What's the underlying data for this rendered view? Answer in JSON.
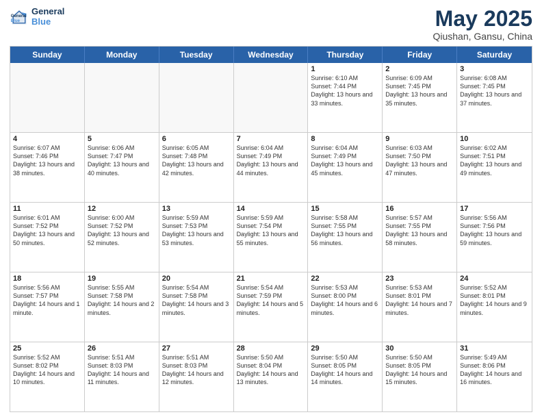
{
  "logo": {
    "line1": "General",
    "line2": "Blue"
  },
  "title": "May 2025",
  "subtitle": "Qiushan, Gansu, China",
  "dayHeaders": [
    "Sunday",
    "Monday",
    "Tuesday",
    "Wednesday",
    "Thursday",
    "Friday",
    "Saturday"
  ],
  "rows": [
    [
      {
        "num": "",
        "info": ""
      },
      {
        "num": "",
        "info": ""
      },
      {
        "num": "",
        "info": ""
      },
      {
        "num": "",
        "info": ""
      },
      {
        "num": "1",
        "info": "Sunrise: 6:10 AM\nSunset: 7:44 PM\nDaylight: 13 hours\nand 33 minutes."
      },
      {
        "num": "2",
        "info": "Sunrise: 6:09 AM\nSunset: 7:45 PM\nDaylight: 13 hours\nand 35 minutes."
      },
      {
        "num": "3",
        "info": "Sunrise: 6:08 AM\nSunset: 7:45 PM\nDaylight: 13 hours\nand 37 minutes."
      }
    ],
    [
      {
        "num": "4",
        "info": "Sunrise: 6:07 AM\nSunset: 7:46 PM\nDaylight: 13 hours\nand 38 minutes."
      },
      {
        "num": "5",
        "info": "Sunrise: 6:06 AM\nSunset: 7:47 PM\nDaylight: 13 hours\nand 40 minutes."
      },
      {
        "num": "6",
        "info": "Sunrise: 6:05 AM\nSunset: 7:48 PM\nDaylight: 13 hours\nand 42 minutes."
      },
      {
        "num": "7",
        "info": "Sunrise: 6:04 AM\nSunset: 7:49 PM\nDaylight: 13 hours\nand 44 minutes."
      },
      {
        "num": "8",
        "info": "Sunrise: 6:04 AM\nSunset: 7:49 PM\nDaylight: 13 hours\nand 45 minutes."
      },
      {
        "num": "9",
        "info": "Sunrise: 6:03 AM\nSunset: 7:50 PM\nDaylight: 13 hours\nand 47 minutes."
      },
      {
        "num": "10",
        "info": "Sunrise: 6:02 AM\nSunset: 7:51 PM\nDaylight: 13 hours\nand 49 minutes."
      }
    ],
    [
      {
        "num": "11",
        "info": "Sunrise: 6:01 AM\nSunset: 7:52 PM\nDaylight: 13 hours\nand 50 minutes."
      },
      {
        "num": "12",
        "info": "Sunrise: 6:00 AM\nSunset: 7:52 PM\nDaylight: 13 hours\nand 52 minutes."
      },
      {
        "num": "13",
        "info": "Sunrise: 5:59 AM\nSunset: 7:53 PM\nDaylight: 13 hours\nand 53 minutes."
      },
      {
        "num": "14",
        "info": "Sunrise: 5:59 AM\nSunset: 7:54 PM\nDaylight: 13 hours\nand 55 minutes."
      },
      {
        "num": "15",
        "info": "Sunrise: 5:58 AM\nSunset: 7:55 PM\nDaylight: 13 hours\nand 56 minutes."
      },
      {
        "num": "16",
        "info": "Sunrise: 5:57 AM\nSunset: 7:55 PM\nDaylight: 13 hours\nand 58 minutes."
      },
      {
        "num": "17",
        "info": "Sunrise: 5:56 AM\nSunset: 7:56 PM\nDaylight: 13 hours\nand 59 minutes."
      }
    ],
    [
      {
        "num": "18",
        "info": "Sunrise: 5:56 AM\nSunset: 7:57 PM\nDaylight: 14 hours\nand 1 minute."
      },
      {
        "num": "19",
        "info": "Sunrise: 5:55 AM\nSunset: 7:58 PM\nDaylight: 14 hours\nand 2 minutes."
      },
      {
        "num": "20",
        "info": "Sunrise: 5:54 AM\nSunset: 7:58 PM\nDaylight: 14 hours\nand 3 minutes."
      },
      {
        "num": "21",
        "info": "Sunrise: 5:54 AM\nSunset: 7:59 PM\nDaylight: 14 hours\nand 5 minutes."
      },
      {
        "num": "22",
        "info": "Sunrise: 5:53 AM\nSunset: 8:00 PM\nDaylight: 14 hours\nand 6 minutes."
      },
      {
        "num": "23",
        "info": "Sunrise: 5:53 AM\nSunset: 8:01 PM\nDaylight: 14 hours\nand 7 minutes."
      },
      {
        "num": "24",
        "info": "Sunrise: 5:52 AM\nSunset: 8:01 PM\nDaylight: 14 hours\nand 9 minutes."
      }
    ],
    [
      {
        "num": "25",
        "info": "Sunrise: 5:52 AM\nSunset: 8:02 PM\nDaylight: 14 hours\nand 10 minutes."
      },
      {
        "num": "26",
        "info": "Sunrise: 5:51 AM\nSunset: 8:03 PM\nDaylight: 14 hours\nand 11 minutes."
      },
      {
        "num": "27",
        "info": "Sunrise: 5:51 AM\nSunset: 8:03 PM\nDaylight: 14 hours\nand 12 minutes."
      },
      {
        "num": "28",
        "info": "Sunrise: 5:50 AM\nSunset: 8:04 PM\nDaylight: 14 hours\nand 13 minutes."
      },
      {
        "num": "29",
        "info": "Sunrise: 5:50 AM\nSunset: 8:05 PM\nDaylight: 14 hours\nand 14 minutes."
      },
      {
        "num": "30",
        "info": "Sunrise: 5:50 AM\nSunset: 8:05 PM\nDaylight: 14 hours\nand 15 minutes."
      },
      {
        "num": "31",
        "info": "Sunrise: 5:49 AM\nSunset: 8:06 PM\nDaylight: 14 hours\nand 16 minutes."
      }
    ]
  ]
}
